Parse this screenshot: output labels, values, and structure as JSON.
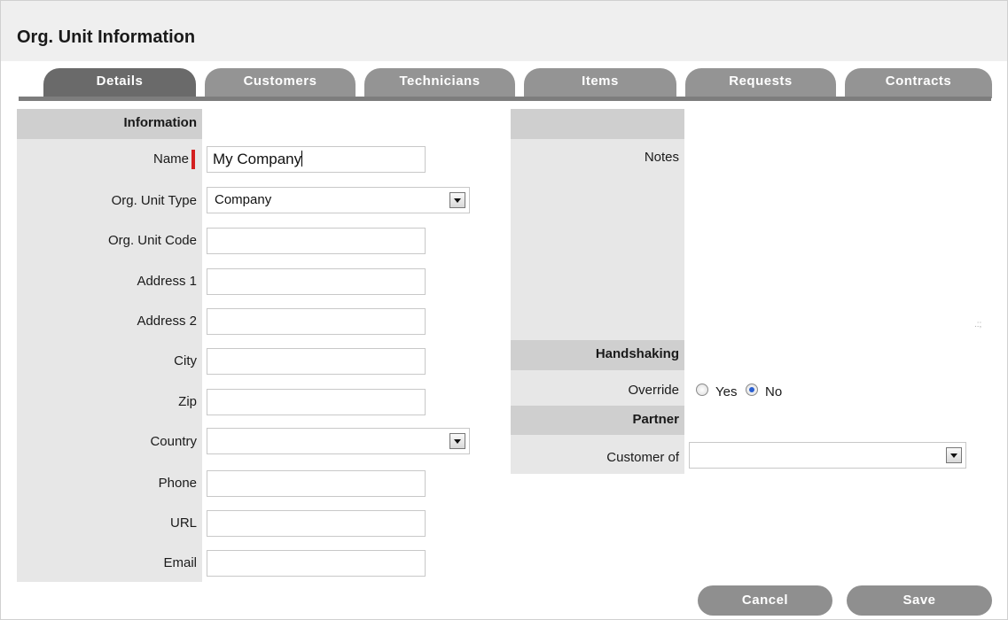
{
  "page": {
    "title": "Org. Unit Information"
  },
  "tabs": [
    {
      "label": "Details",
      "active": true
    },
    {
      "label": "Customers",
      "active": false
    },
    {
      "label": "Technicians",
      "active": false
    },
    {
      "label": "Items",
      "active": false
    },
    {
      "label": "Requests",
      "active": false
    },
    {
      "label": "Contracts",
      "active": false
    }
  ],
  "info": {
    "header": "Information",
    "name": {
      "label": "Name",
      "value": "My Company"
    },
    "org_unit_type": {
      "label": "Org. Unit Type",
      "value": "Company"
    },
    "org_unit_code": {
      "label": "Org. Unit Code",
      "value": ""
    },
    "address1": {
      "label": "Address 1",
      "value": ""
    },
    "address2": {
      "label": "Address 2",
      "value": ""
    },
    "city": {
      "label": "City",
      "value": ""
    },
    "zip": {
      "label": "Zip",
      "value": ""
    },
    "country": {
      "label": "Country",
      "value": ""
    },
    "phone": {
      "label": "Phone",
      "value": ""
    },
    "url": {
      "label": "URL",
      "value": ""
    },
    "email": {
      "label": "Email",
      "value": ""
    }
  },
  "notes": {
    "label": "Notes",
    "value": ""
  },
  "handshaking": {
    "header": "Handshaking",
    "override_label": "Override",
    "yes_label": "Yes",
    "no_label": "No",
    "selected": "No"
  },
  "partner": {
    "header": "Partner",
    "customer_of_label": "Customer of",
    "customer_of_value": ""
  },
  "actions": {
    "cancel": "Cancel",
    "save": "Save"
  },
  "colors": {
    "tab_active": "#6a6a6a",
    "tab_inactive": "#949494",
    "required": "#d32020",
    "section_header": "#cfcfcf"
  }
}
